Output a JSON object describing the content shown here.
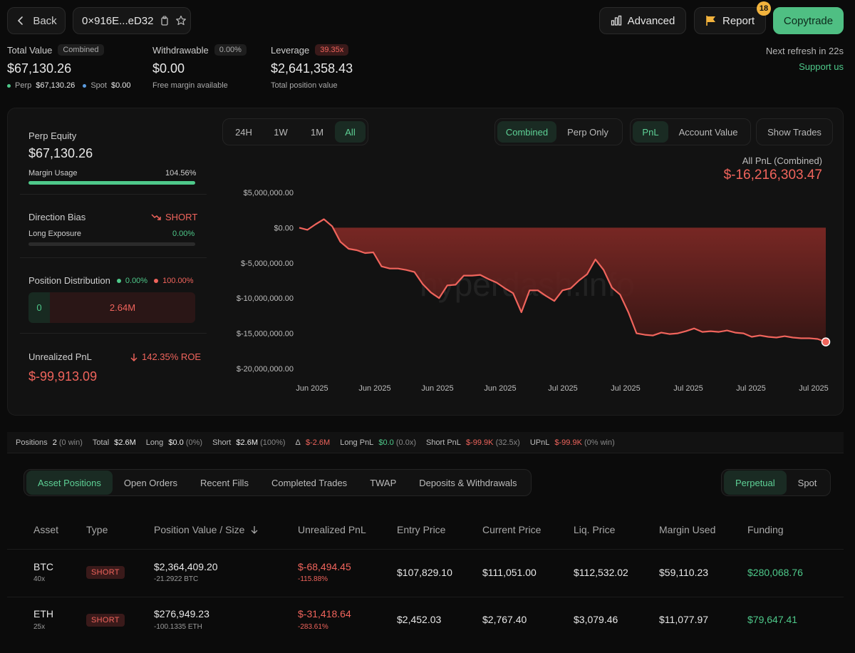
{
  "header": {
    "back_label": "Back",
    "address": "0×916E...eD32",
    "advanced_label": "Advanced",
    "report_label": "Report",
    "report_count": "18",
    "copytrade_label": "Copytrade"
  },
  "summary": {
    "total_value_label": "Total Value",
    "total_value_badge": "Combined",
    "total_value": "$67,130.26",
    "perp_label": "Perp",
    "perp_value": "$67,130.26",
    "spot_label": "Spot",
    "spot_value": "$0.00",
    "withdrawable_label": "Withdrawable",
    "withdrawable_badge": "0.00%",
    "withdrawable_value": "$0.00",
    "withdrawable_sub": "Free margin available",
    "leverage_label": "Leverage",
    "leverage_badge": "39.35x",
    "leverage_value": "$2,641,358.43",
    "leverage_sub": "Total position value",
    "refresh_text": "Next refresh in 22s",
    "support_label": "Support us"
  },
  "left_panel": {
    "perp_equity_label": "Perp Equity",
    "perp_equity_value": "$67,130.26",
    "margin_usage_label": "Margin Usage",
    "margin_usage_value": "104.56%",
    "margin_usage_fraction": 1.0,
    "direction_bias_label": "Direction Bias",
    "direction_bias_value": "SHORT",
    "long_exposure_label": "Long Exposure",
    "long_exposure_value": "0.00%",
    "position_dist_label": "Position Distribution",
    "dist_long_pct": "0.00%",
    "dist_short_pct": "100.00%",
    "dist_long_value": "0",
    "dist_short_value": "2.64M",
    "upnl_label": "Unrealized PnL",
    "upnl_roe": "142.35% ROE",
    "upnl_value": "$-99,913.09"
  },
  "chart_controls": {
    "ranges": [
      "24H",
      "1W",
      "1M",
      "All"
    ],
    "modes": [
      "Combined",
      "Perp Only"
    ],
    "metrics": [
      "PnL",
      "Account Value"
    ],
    "show_trades_label": "Show Trades"
  },
  "chart_summary": {
    "label": "All PnL (Combined)",
    "value": "$-16,216,303.47"
  },
  "watermark": "hyperdash.info",
  "chart_data": {
    "type": "area",
    "title": "All PnL (Combined)",
    "xlabel": "",
    "ylabel": "",
    "ylim": [
      -20000000,
      5000000
    ],
    "y_ticks": [
      "$5,000,000.00",
      "$0.00",
      "$-5,000,000.00",
      "$-10,000,000.00",
      "$-15,000,000.00",
      "$-20,000,000.00"
    ],
    "y_tick_values": [
      5000000,
      0,
      -5000000,
      -10000000,
      -15000000,
      -20000000
    ],
    "x_ticks": [
      "Jun 2025",
      "Jun 2025",
      "Jun 2025",
      "Jun 2025",
      "Jul 2025",
      "Jul 2025",
      "Jul 2025",
      "Jul 2025",
      "Jul 2025"
    ],
    "grid": false,
    "series": [
      {
        "values": [
          0,
          -300000,
          500000,
          1200000,
          200000,
          -2000000,
          -3000000,
          -3200000,
          -3600000,
          -3500000,
          -5500000,
          -5800000,
          -5800000,
          -6000000,
          -6300000,
          -8000000,
          -9200000,
          -10000000,
          -8200000,
          -8100000,
          -6800000,
          -6800000,
          -6700000,
          -7300000,
          -7800000,
          -8600000,
          -9300000,
          -12000000,
          -8900000,
          -8900000,
          -9700000,
          -10400000,
          -8900000,
          -8600000,
          -7500000,
          -6600000,
          -4500000,
          -6000000,
          -8500000,
          -9500000,
          -12000000,
          -15000000,
          -15200000,
          -15300000,
          -14900000,
          -15100000,
          -15000000,
          -14700000,
          -14300000,
          -14800000,
          -14700000,
          -14800000,
          -14600000,
          -14900000,
          -15000000,
          -15500000,
          -15300000,
          -15500000,
          -15600000,
          -15400000,
          -15600000,
          -15700000,
          -15700000,
          -15800000,
          -16216303
        ]
      }
    ]
  },
  "stats_strip": {
    "positions_label": "Positions",
    "positions_value": "2",
    "positions_sub": "(0 win)",
    "total_label": "Total",
    "total_value": "$2.6M",
    "long_label": "Long",
    "long_value": "$0.0",
    "long_sub": "(0%)",
    "short_label": "Short",
    "short_value": "$2.6M",
    "short_sub": "(100%)",
    "delta_label": "Δ",
    "delta_value": "$-2.6M",
    "long_pnl_label": "Long PnL",
    "long_pnl_value": "$0.0",
    "long_pnl_sub": "(0.0x)",
    "short_pnl_label": "Short PnL",
    "short_pnl_value": "$-99.9K",
    "short_pnl_sub": "(32.5x)",
    "upnl_label": "UPnL",
    "upnl_value": "$-99.9K",
    "upnl_sub": "(0% win)"
  },
  "tabs": [
    "Asset Positions",
    "Open Orders",
    "Recent Fills",
    "Completed Trades",
    "TWAP",
    "Deposits & Withdrawals"
  ],
  "market_tabs": [
    "Perpetual",
    "Spot"
  ],
  "table": {
    "headers": [
      "Asset",
      "Type",
      "Position Value / Size",
      "Unrealized PnL",
      "Entry Price",
      "Current Price",
      "Liq. Price",
      "Margin Used",
      "Funding"
    ],
    "rows": [
      {
        "asset": "BTC",
        "leverage": "40x",
        "type": "SHORT",
        "value": "$2,364,409.20",
        "size": "-21.2922 BTC",
        "upnl": "$-68,494.45",
        "upnl_pct": "-115.88%",
        "entry": "$107,829.10",
        "current": "$111,051.00",
        "liq": "$112,532.02",
        "margin": "$59,110.23",
        "funding": "$280,068.76"
      },
      {
        "asset": "ETH",
        "leverage": "25x",
        "type": "SHORT",
        "value": "$276,949.23",
        "size": "-100.1335 ETH",
        "upnl": "$-31,418.64",
        "upnl_pct": "-283.61%",
        "entry": "$2,452.03",
        "current": "$2,767.40",
        "liq": "$3,079.46",
        "margin": "$11,077.97",
        "funding": "$79,647.41"
      }
    ]
  },
  "colors": {
    "accent_green": "#4ec98a",
    "loss_red": "#f0645c",
    "copytrade_bg": "#4fbf83",
    "report_badge": "#f2b33d"
  }
}
